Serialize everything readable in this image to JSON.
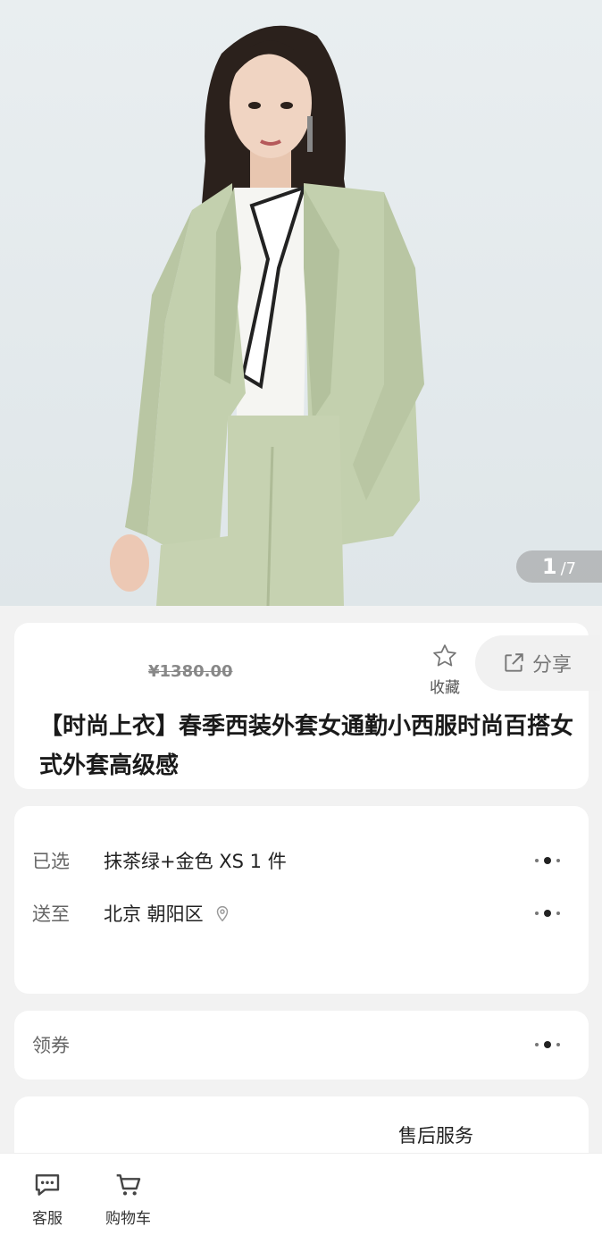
{
  "gallery": {
    "current": "1",
    "total": "/7"
  },
  "product": {
    "original_price": "¥1380.00",
    "title": "【时尚上衣】春季西装外套女通勤小西服时尚百搭女式外套高级感"
  },
  "actions": {
    "favorite_label": "收藏",
    "share_label": "分享"
  },
  "spec": {
    "selected_key": "已选",
    "selected_value": "抹茶绿+金色 XS 1 件",
    "ship_key": "送至",
    "ship_value": "北京 朝阳区"
  },
  "coupon": {
    "label": "领券"
  },
  "service": {
    "label": "售后服务"
  },
  "bottom_bar": {
    "service_label": "客服",
    "cart_label": "购物车"
  },
  "colors": {
    "jacket": "#c3d0ae",
    "background": "#f2f2f2"
  }
}
